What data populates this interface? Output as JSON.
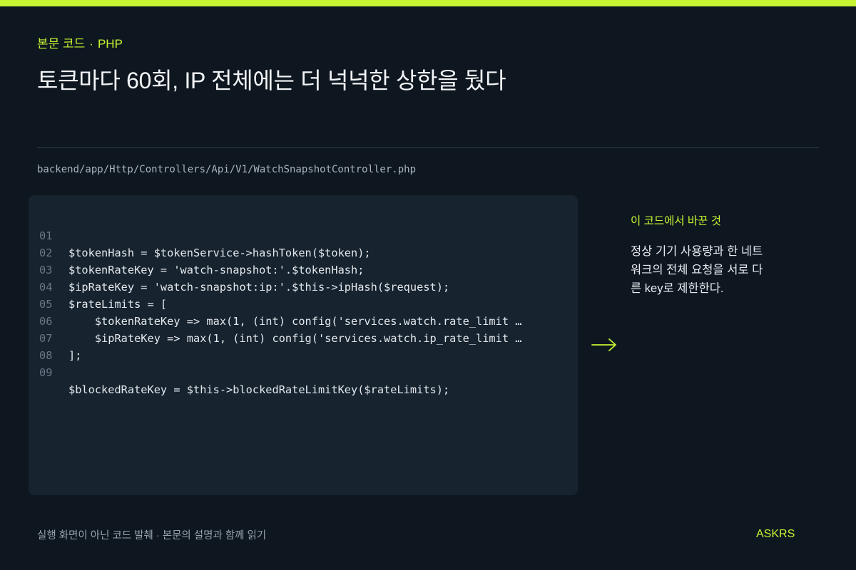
{
  "eyebrow": {
    "section": "본문 코드",
    "separator": "·",
    "language": "PHP"
  },
  "headline": "토큰마다 60회, IP 전체에는 더 넉넉한 상한을 뒀다",
  "file_path": "backend/app/Http/Controllers/Api/V1/WatchSnapshotController.php",
  "code": {
    "lines": [
      {
        "no": "01",
        "text": "$tokenHash = $tokenService->hashToken($token);"
      },
      {
        "no": "02",
        "text": "$tokenRateKey = 'watch-snapshot:'.$tokenHash;"
      },
      {
        "no": "03",
        "text": "$ipRateKey = 'watch-snapshot:ip:'.$this->ipHash($request);"
      },
      {
        "no": "04",
        "text": "$rateLimits = ["
      },
      {
        "no": "05",
        "text": "    $tokenRateKey => max(1, (int) config('services.watch.rate_limit …"
      },
      {
        "no": "06",
        "text": "    $ipRateKey => max(1, (int) config('services.watch.ip_rate_limit …"
      },
      {
        "no": "07",
        "text": "];"
      },
      {
        "no": "08",
        "text": ""
      },
      {
        "no": "09",
        "text": "$blockedRateKey = $this->blockedRateLimitKey($rateLimits);"
      }
    ]
  },
  "arrow_icon": "arrow-right-icon",
  "note": {
    "title": "이 코드에서 바꾼 것",
    "body_lines": [
      "정상 기기 사용량과 한 네트",
      "워크의 전체 요청을 서로 다",
      "른 key로 제한한다."
    ]
  },
  "footer": {
    "caption": "실행 화면이 아닌 코드 발췌 · 본문의 설명과 함께 읽기",
    "brand": "ASKRS"
  },
  "colors": {
    "background": "#0e1720",
    "accent": "#c6f432",
    "code_panel": "#17232f"
  }
}
